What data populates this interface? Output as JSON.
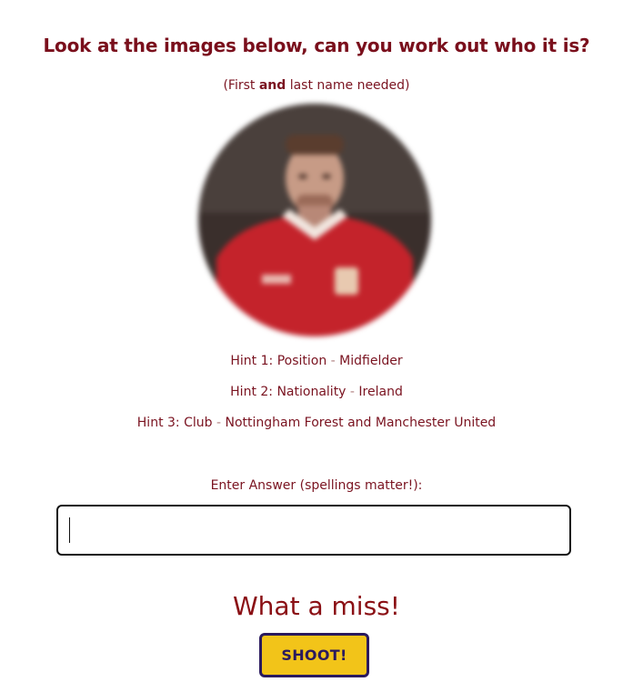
{
  "quiz": {
    "title": "Look at the images below, can you work out who it is?",
    "subtitle_prefix": "(First ",
    "subtitle_bold": "and",
    "subtitle_suffix": " last name needed)",
    "hints": [
      {
        "label": "Hint 1: Position",
        "value": "Midfielder"
      },
      {
        "label": "Hint 2: Nationality",
        "value": "Ireland"
      },
      {
        "label": "Hint 3: Club",
        "value": "Nottingham Forest and Manchester United"
      }
    ],
    "hint_separator": " - "
  },
  "answer": {
    "label": "Enter Answer (spellings matter!):",
    "value": "",
    "placeholder": ""
  },
  "result": {
    "message": "What a miss!"
  },
  "button": {
    "label": "SHOOT!"
  },
  "colors": {
    "text": "#7a1320",
    "button_bg": "#f2c419",
    "button_border": "#2a1a5e"
  }
}
